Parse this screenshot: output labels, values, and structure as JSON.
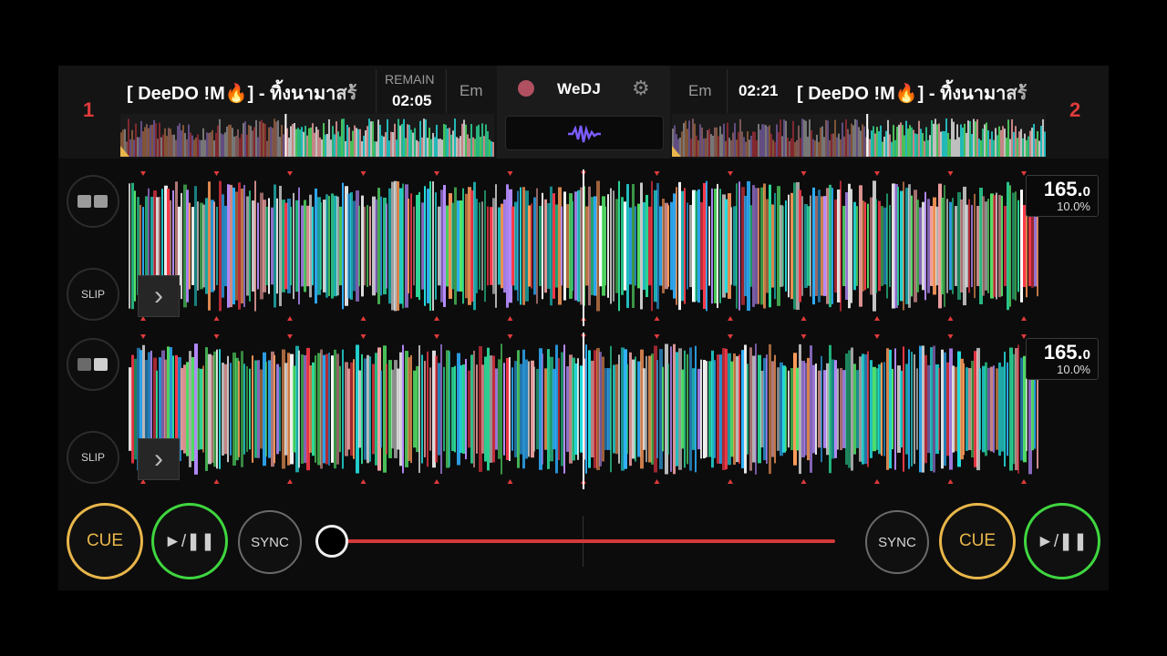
{
  "colors": {
    "accent_red": "#e03a3a",
    "cue": "#e8b64a",
    "play": "#3fd63f",
    "sync": "#6a6a6a",
    "waveform_palette": [
      "#25e0e0",
      "#2ddc9a",
      "#57e86a",
      "#f0a0a0",
      "#e8e8e8",
      "#ff3a4a",
      "#b78cff",
      "#ff9c5a",
      "#30b0ff",
      "#ffffff"
    ]
  },
  "center": {
    "brand": "WeDJ",
    "record_icon": "record-icon",
    "settings_icon": "gear-icon",
    "waveform_toggle_icon": "waveform-icon"
  },
  "deck1": {
    "number": "1",
    "title": "[ DeeDO !M🔥] - ทิ้งนามาสร้",
    "remain_label": "REMAIN",
    "time": "02:05",
    "key": "Em",
    "bpm": "165.",
    "bpm_decimal": "0",
    "pitch": "10.0%",
    "overview_progress": 0.44
  },
  "deck2": {
    "number": "2",
    "title": "[ DeeDO !M🔥] - ทิ้งนามาสร้",
    "time": "02:21",
    "key": "Em",
    "bpm": "165.",
    "bpm_decimal": "0",
    "pitch": "10.0%",
    "overview_progress": 0.52
  },
  "side_buttons": {
    "slip": "SLIP"
  },
  "transport": {
    "cue": "CUE",
    "play": "►/❚❚",
    "sync": "SYNC"
  },
  "crossfader": {
    "position": 0
  }
}
